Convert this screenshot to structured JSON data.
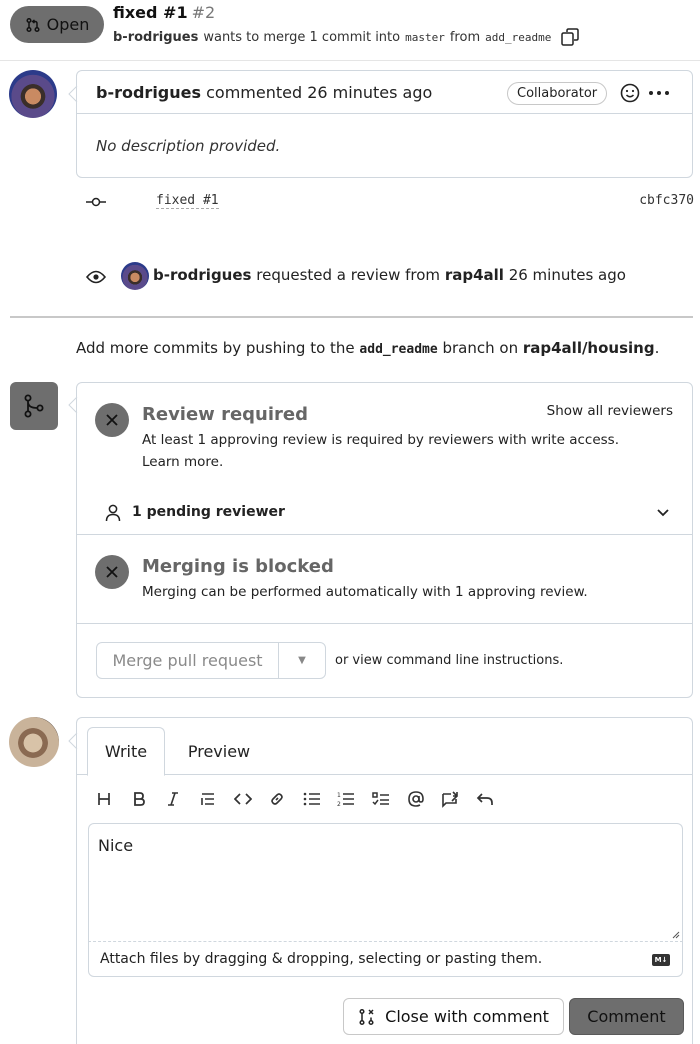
{
  "header": {
    "state_label": "Open",
    "title": "fixed #1",
    "number": "#2",
    "author": "b-rodrigues",
    "merge_text_1": "wants to merge 1 commit into",
    "base_branch": "master",
    "merge_text_2": "from",
    "head_branch": "add_readme"
  },
  "comment": {
    "author": "b-rodrigues",
    "action": "commented 26 minutes ago",
    "badge": "Collaborator",
    "body": "No description provided."
  },
  "commit": {
    "message": "fixed #1",
    "sha": "cbfc370"
  },
  "review_event": {
    "actor": "b-rodrigues",
    "text": "requested a review from",
    "reviewer": "rap4all",
    "time": "26 minutes ago"
  },
  "push_note": {
    "prefix": "Add more commits by pushing to the",
    "branch": "add_readme",
    "middle": "branch on",
    "repo": "rap4all/housing",
    "suffix": "."
  },
  "merge_box": {
    "review_title": "Review required",
    "review_text": "At least 1 approving review is required by reviewers with write access.",
    "learn_more": "Learn more.",
    "show_all": "Show all reviewers",
    "pending": "1 pending reviewer",
    "blocked_title": "Merging is blocked",
    "blocked_text": "Merging can be performed automatically with 1 approving review.",
    "merge_button": "Merge pull request",
    "cli_note": "or view command line instructions."
  },
  "editor": {
    "tab_write": "Write",
    "tab_preview": "Preview",
    "content": "Nice",
    "attach_text": "Attach files by dragging & dropping, selecting or pasting them.",
    "md_badge": "M↓",
    "close_button": "Close with comment",
    "comment_button": "Comment",
    "toolbar": [
      "heading-icon",
      "bold-icon",
      "italic-icon",
      "quote-icon",
      "code-icon",
      "link-icon",
      "bulleted-list-icon",
      "numbered-list-icon",
      "task-list-icon",
      "mention-icon",
      "reference-icon",
      "undo-icon"
    ]
  }
}
